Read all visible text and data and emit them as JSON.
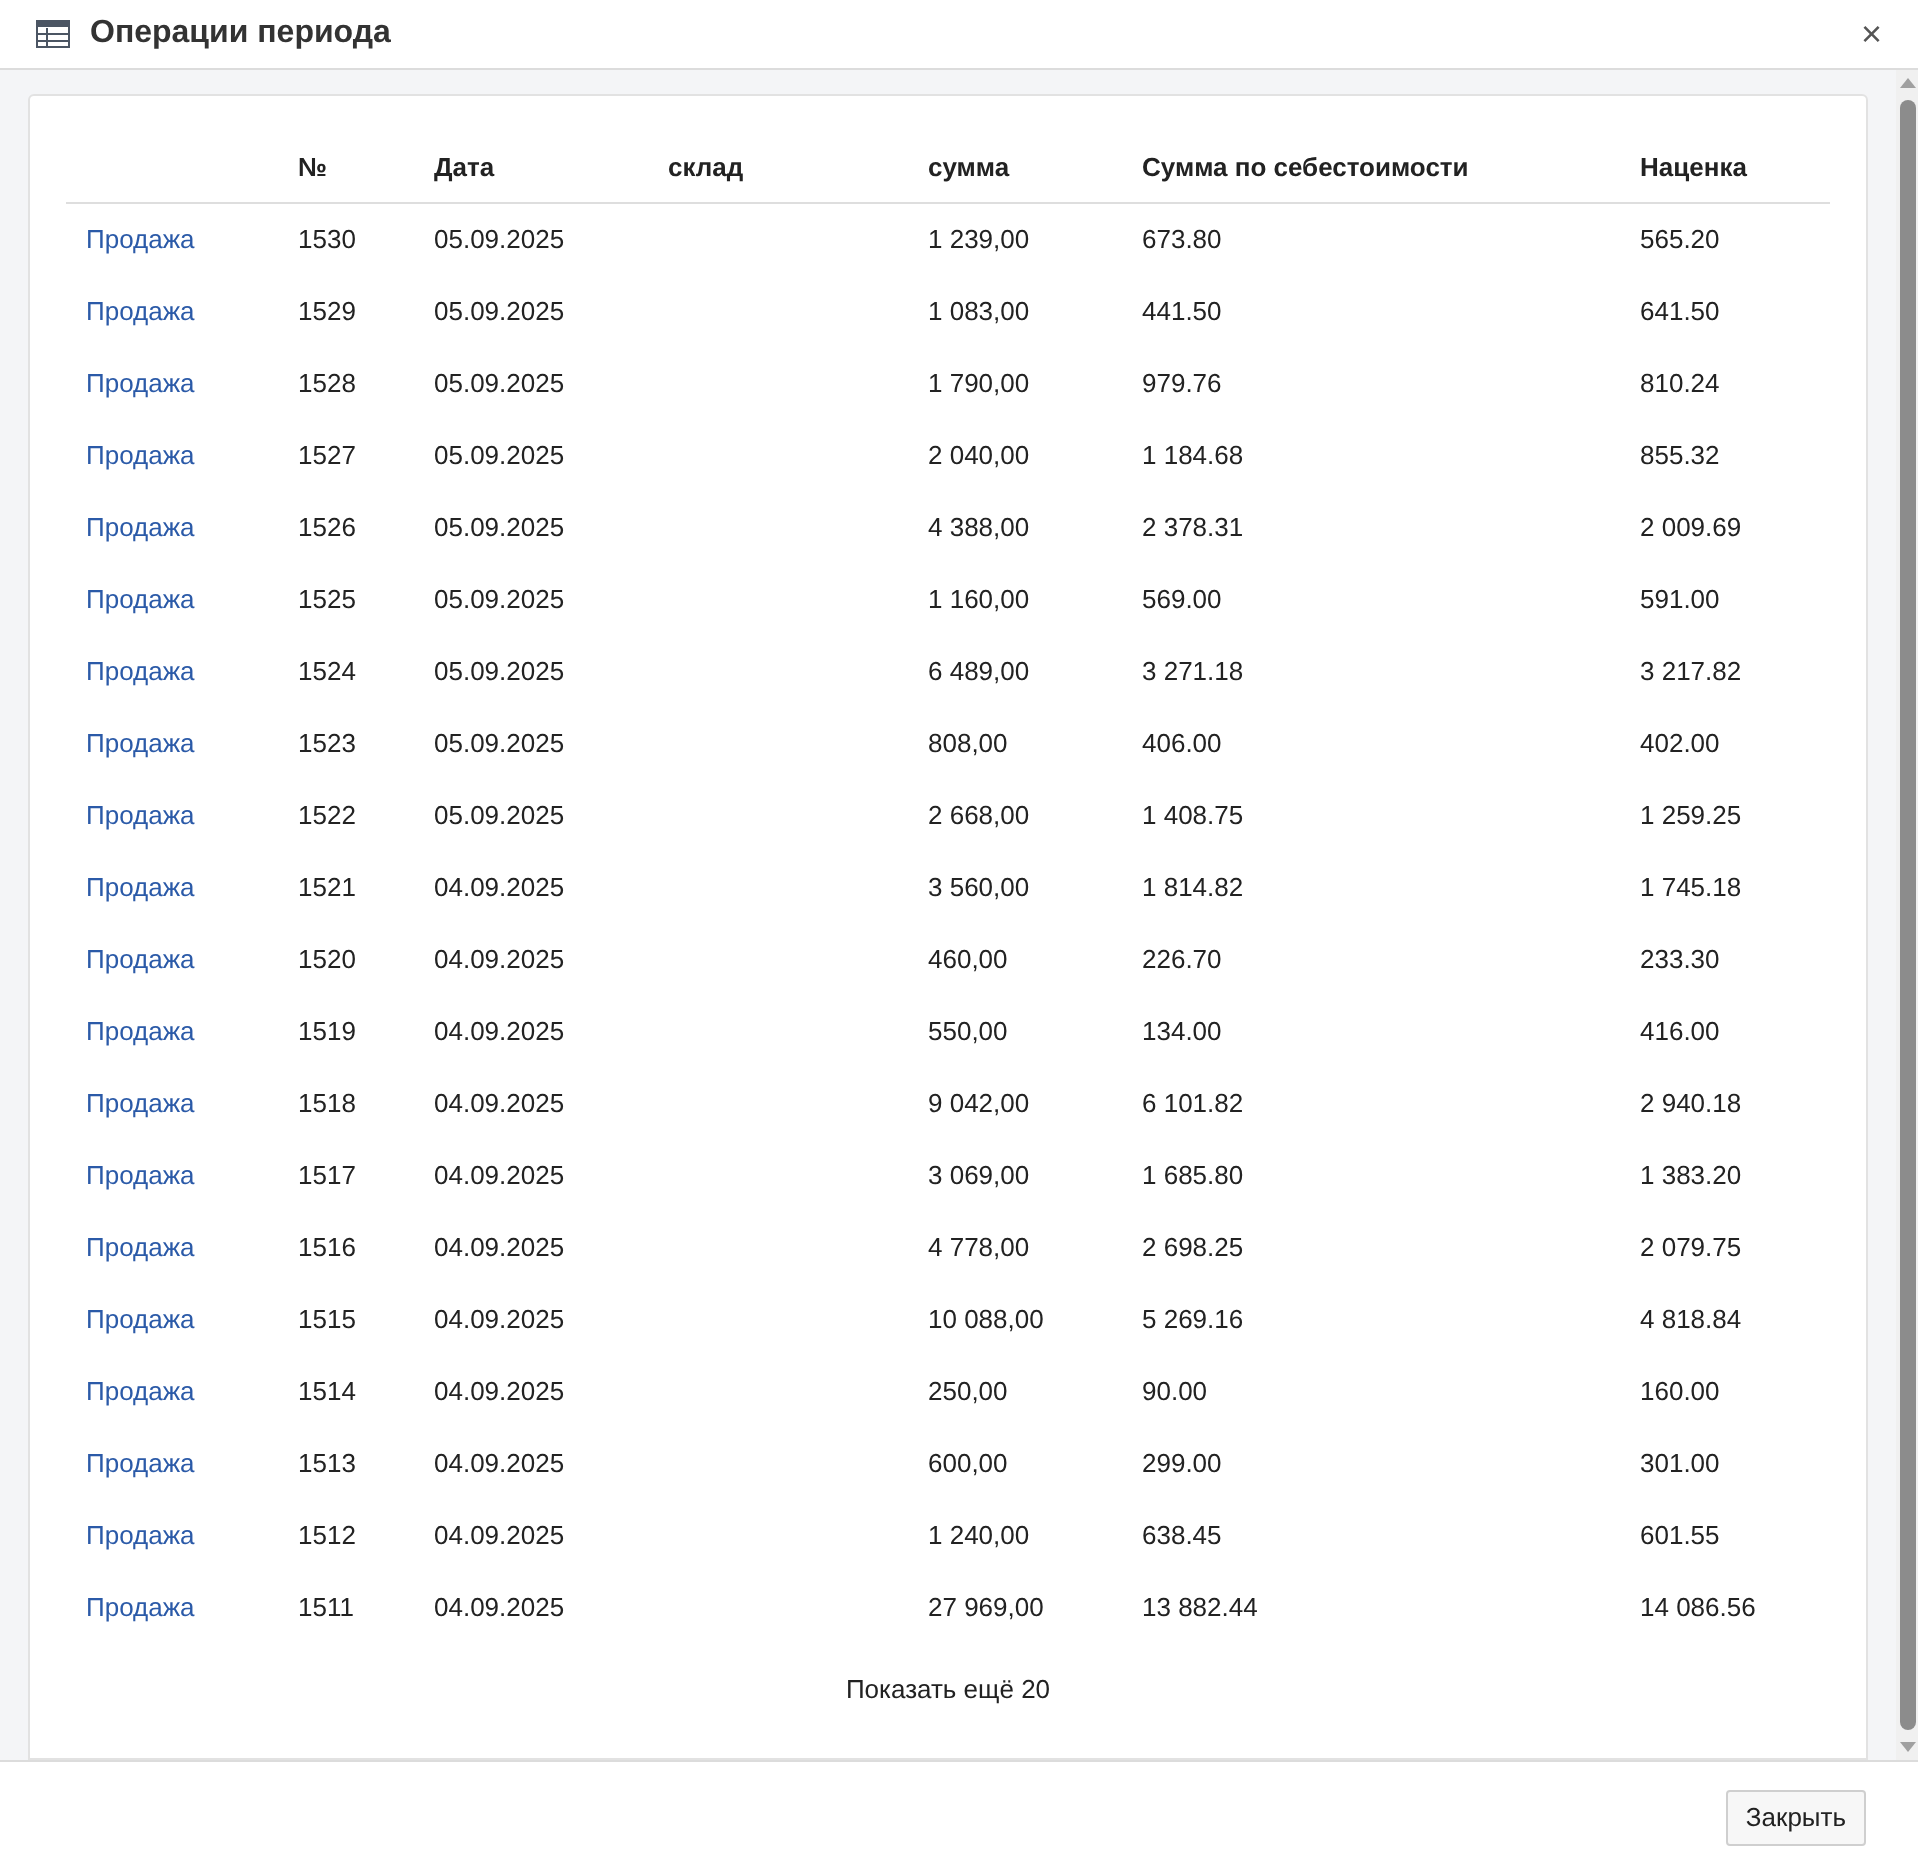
{
  "window": {
    "title": "Операции периода",
    "close": "×"
  },
  "table": {
    "columns": [
      "",
      "№",
      "Дата",
      "склад",
      "сумма",
      "Сумма по себестоимости",
      "Наценка"
    ],
    "rows": [
      [
        "Продажа",
        "1530",
        "05.09.2025",
        "",
        "1 239,00",
        "673.80",
        "565.20"
      ],
      [
        "Продажа",
        "1529",
        "05.09.2025",
        "",
        "1 083,00",
        "441.50",
        "641.50"
      ],
      [
        "Продажа",
        "1528",
        "05.09.2025",
        "",
        "1 790,00",
        "979.76",
        "810.24"
      ],
      [
        "Продажа",
        "1527",
        "05.09.2025",
        "",
        "2 040,00",
        "1 184.68",
        "855.32"
      ],
      [
        "Продажа",
        "1526",
        "05.09.2025",
        "",
        "4 388,00",
        "2 378.31",
        "2 009.69"
      ],
      [
        "Продажа",
        "1525",
        "05.09.2025",
        "",
        "1 160,00",
        "569.00",
        "591.00"
      ],
      [
        "Продажа",
        "1524",
        "05.09.2025",
        "",
        "6 489,00",
        "3 271.18",
        "3 217.82"
      ],
      [
        "Продажа",
        "1523",
        "05.09.2025",
        "",
        "808,00",
        "406.00",
        "402.00"
      ],
      [
        "Продажа",
        "1522",
        "05.09.2025",
        "",
        "2 668,00",
        "1 408.75",
        "1 259.25"
      ],
      [
        "Продажа",
        "1521",
        "04.09.2025",
        "",
        "3 560,00",
        "1 814.82",
        "1 745.18"
      ],
      [
        "Продажа",
        "1520",
        "04.09.2025",
        "",
        "460,00",
        "226.70",
        "233.30"
      ],
      [
        "Продажа",
        "1519",
        "04.09.2025",
        "",
        "550,00",
        "134.00",
        "416.00"
      ],
      [
        "Продажа",
        "1518",
        "04.09.2025",
        "",
        "9 042,00",
        "6 101.82",
        "2 940.18"
      ],
      [
        "Продажа",
        "1517",
        "04.09.2025",
        "",
        "3 069,00",
        "1 685.80",
        "1 383.20"
      ],
      [
        "Продажа",
        "1516",
        "04.09.2025",
        "",
        "4 778,00",
        "2 698.25",
        "2 079.75"
      ],
      [
        "Продажа",
        "1515",
        "04.09.2025",
        "",
        "10 088,00",
        "5 269.16",
        "4 818.84"
      ],
      [
        "Продажа",
        "1514",
        "04.09.2025",
        "",
        "250,00",
        "90.00",
        "160.00"
      ],
      [
        "Продажа",
        "1513",
        "04.09.2025",
        "",
        "600,00",
        "299.00",
        "301.00"
      ],
      [
        "Продажа",
        "1512",
        "04.09.2025",
        "",
        "1 240,00",
        "638.45",
        "601.55"
      ],
      [
        "Продажа",
        "1511",
        "04.09.2025",
        "",
        "27 969,00",
        "13 882.44",
        "14 086.56"
      ]
    ]
  },
  "show_more": "Показать ещё 20",
  "buttons": [
    "Закрыть"
  ]
}
